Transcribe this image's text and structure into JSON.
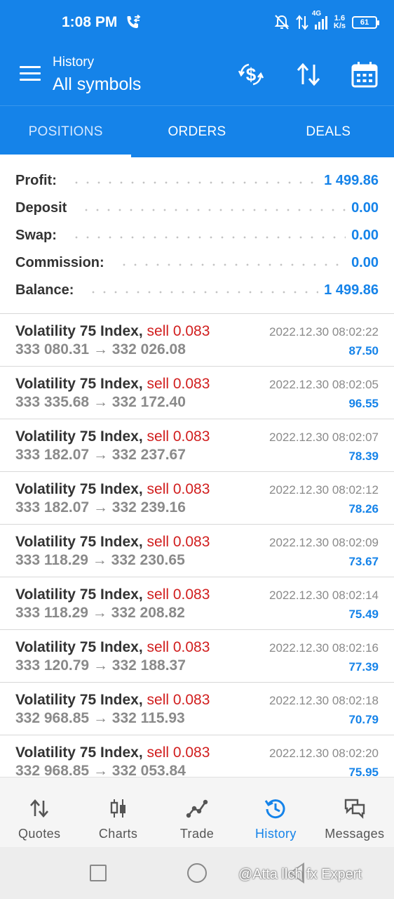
{
  "status_bar": {
    "time": "1:08 PM",
    "network_type": "4G",
    "speed": "1.6",
    "speed_unit": "K/s",
    "battery": "61",
    "icons": [
      "call-forwarding-icon",
      "bell-off-icon",
      "data-arrows-icon",
      "signal-icon",
      "battery-icon"
    ]
  },
  "app_bar": {
    "subtitle": "History",
    "title": "All symbols",
    "icons": [
      "menu-icon",
      "dollar-exchange-icon",
      "sort-icon",
      "calendar-icon"
    ]
  },
  "tabs": [
    {
      "label": "POSITIONS",
      "active": true
    },
    {
      "label": "ORDERS",
      "active": false
    },
    {
      "label": "DEALS",
      "active": false
    }
  ],
  "summary": [
    {
      "label": "Profit:",
      "value": "1 499.86"
    },
    {
      "label": "Deposit",
      "value": "0.00"
    },
    {
      "label": "Swap:",
      "value": "0.00"
    },
    {
      "label": "Commission:",
      "value": "0.00"
    },
    {
      "label": "Balance:",
      "value": "1 499.86"
    }
  ],
  "deals": [
    {
      "symbol": "Volatility 75 Index,",
      "type": "sell 0.083",
      "open": "333 080.31",
      "arrow": "→",
      "close": "332 026.08",
      "time": "2022.12.30 08:02:22",
      "profit": "87.50"
    },
    {
      "symbol": "Volatility 75 Index,",
      "type": "sell 0.083",
      "open": "333 335.68",
      "arrow": "→",
      "close": "332 172.40",
      "time": "2022.12.30 08:02:05",
      "profit": "96.55"
    },
    {
      "symbol": "Volatility 75 Index,",
      "type": "sell 0.083",
      "open": "333 182.07",
      "arrow": "→",
      "close": "332 237.67",
      "time": "2022.12.30 08:02:07",
      "profit": "78.39"
    },
    {
      "symbol": "Volatility 75 Index,",
      "type": "sell 0.083",
      "open": "333 182.07",
      "arrow": "→",
      "close": "332 239.16",
      "time": "2022.12.30 08:02:12",
      "profit": "78.26"
    },
    {
      "symbol": "Volatility 75 Index,",
      "type": "sell 0.083",
      "open": "333 118.29",
      "arrow": "→",
      "close": "332 230.65",
      "time": "2022.12.30 08:02:09",
      "profit": "73.67"
    },
    {
      "symbol": "Volatility 75 Index,",
      "type": "sell 0.083",
      "open": "333 118.29",
      "arrow": "→",
      "close": "332 208.82",
      "time": "2022.12.30 08:02:14",
      "profit": "75.49"
    },
    {
      "symbol": "Volatility 75 Index,",
      "type": "sell 0.083",
      "open": "333 120.79",
      "arrow": "→",
      "close": "332 188.37",
      "time": "2022.12.30 08:02:16",
      "profit": "77.39"
    },
    {
      "symbol": "Volatility 75 Index,",
      "type": "sell 0.083",
      "open": "332 968.85",
      "arrow": "→",
      "close": "332 115.93",
      "time": "2022.12.30 08:02:18",
      "profit": "70.79"
    },
    {
      "symbol": "Volatility 75 Index,",
      "type": "sell 0.083",
      "open": "332 968.85",
      "arrow": "→",
      "close": "332 053.84",
      "time": "2022.12.30 08:02:20",
      "profit": "75.95"
    }
  ],
  "bottom_nav": [
    {
      "label": "Quotes",
      "icon": "quotes-arrows-icon",
      "active": false
    },
    {
      "label": "Charts",
      "icon": "candlestick-icon",
      "active": false
    },
    {
      "label": "Trade",
      "icon": "trade-line-icon",
      "active": false
    },
    {
      "label": "History",
      "icon": "history-clock-icon",
      "active": true
    },
    {
      "label": "Messages",
      "icon": "chat-bubbles-icon",
      "active": false
    }
  ],
  "watermark": "@Atta llch fx Expert",
  "colors": {
    "primary": "#1583e9",
    "sell": "#d11e1e",
    "muted": "#8a8a8a"
  }
}
